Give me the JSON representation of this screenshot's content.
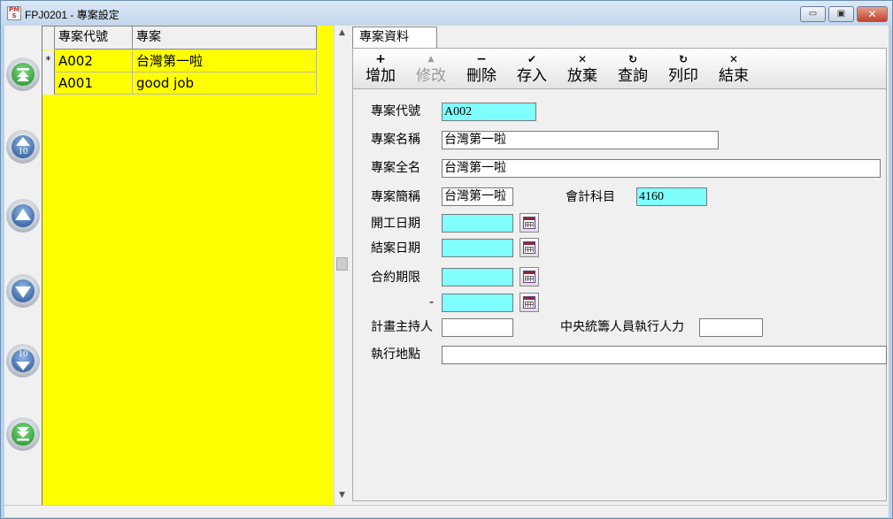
{
  "window": {
    "title": "FPJ0201 - 專案設定",
    "minimize_glyph": "▭",
    "maximize_glyph": "▣",
    "close_glyph": "✕"
  },
  "nav": {
    "page_step": "10",
    "icons": [
      "first-record-icon",
      "page-up-10-icon",
      "previous-record-icon",
      "next-record-icon",
      "page-down-10-icon",
      "last-record-icon"
    ]
  },
  "grid": {
    "columns": [
      "專案代號",
      "專案"
    ],
    "rows": [
      {
        "indicator": "*",
        "code": "A002",
        "name": "台灣第一啦"
      },
      {
        "indicator": "",
        "code": "A001",
        "name": "good job"
      }
    ],
    "background": "#ffff00"
  },
  "tab": {
    "label": "專案資料"
  },
  "toolbar": {
    "buttons": [
      {
        "icon": "+",
        "label": "增加",
        "enabled": true
      },
      {
        "icon": "▲",
        "label": "修改",
        "enabled": false
      },
      {
        "icon": "−",
        "label": "刪除",
        "enabled": true
      },
      {
        "icon": "✔",
        "label": "存入",
        "enabled": true
      },
      {
        "icon": "✕",
        "label": "放棄",
        "enabled": true
      },
      {
        "icon": "↻",
        "label": "查詢",
        "enabled": true
      },
      {
        "icon": "↻",
        "label": "列印",
        "enabled": true
      },
      {
        "icon": "✕",
        "label": "結束",
        "enabled": true
      }
    ]
  },
  "form": {
    "project_code": {
      "label": "專案代號",
      "value": "A002"
    },
    "project_name": {
      "label": "專案名稱",
      "value": "台灣第一啦"
    },
    "project_fullname": {
      "label": "專案全名",
      "value": "台灣第一啦"
    },
    "project_shortname": {
      "label": "專案簡稱",
      "value": "台灣第一啦"
    },
    "account_subject": {
      "label": "會計科目",
      "value": "4160"
    },
    "start_date": {
      "label": "開工日期",
      "value": ""
    },
    "close_date": {
      "label": "結案日期",
      "value": ""
    },
    "contract_period": {
      "label": "合約期限",
      "from": "",
      "separator": "-",
      "to": ""
    },
    "plan_host": {
      "label": "計畫主持人",
      "value": ""
    },
    "central_staff": {
      "label": "中央統籌人員執行人力",
      "value": ""
    },
    "location": {
      "label": "執行地點",
      "value": ""
    }
  },
  "colors": {
    "required_field": "#80ffff",
    "grid_background": "#ffff00"
  }
}
